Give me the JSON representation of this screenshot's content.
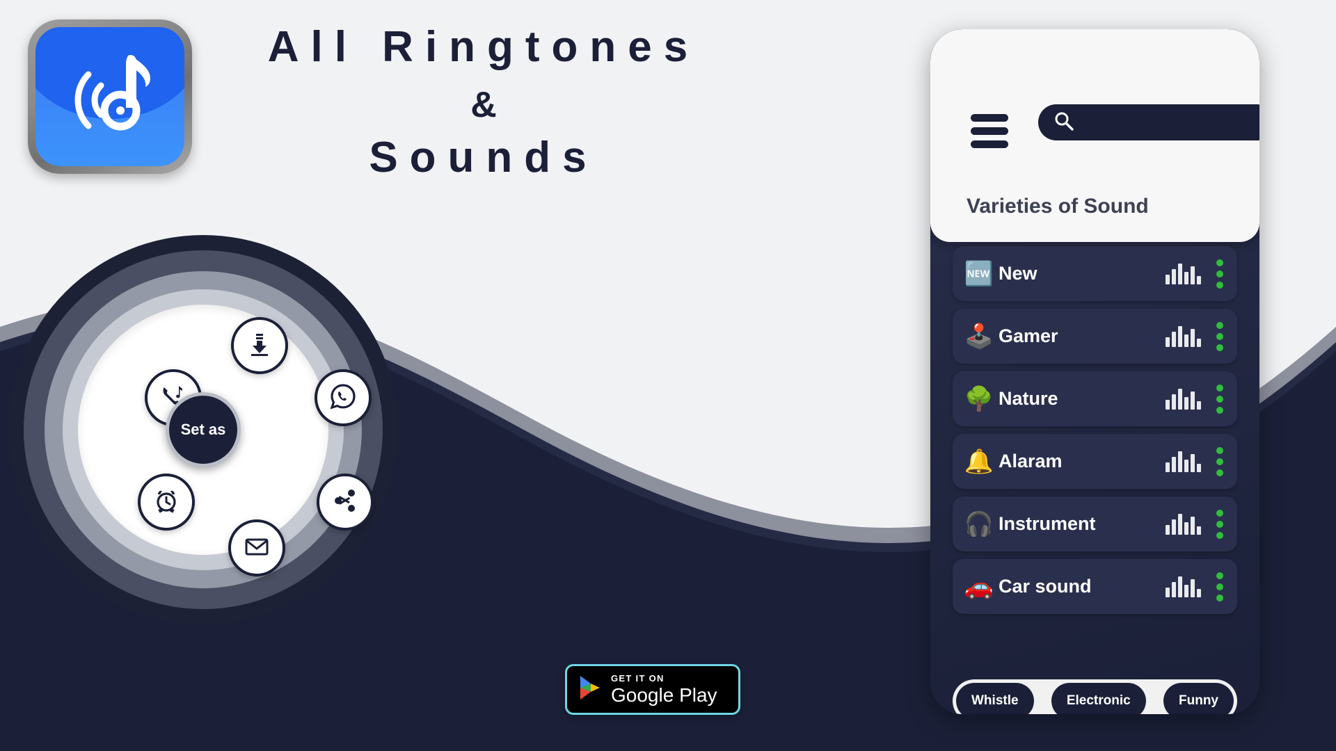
{
  "app": {
    "icon_name": "music-note-waves-icon",
    "icon_colors": {
      "bg_top": "#1f63ef",
      "bg_bottom": "#3d93fb",
      "frame": "#8b8b8b"
    }
  },
  "title": {
    "line1": "All Ringtones",
    "line2": "&",
    "line3": "Sounds",
    "color": "#1b1f38"
  },
  "radial_menu": {
    "center_label": "Set as",
    "center_color": "#1b2038",
    "items": [
      {
        "name": "download",
        "icon": "download-icon"
      },
      {
        "name": "ringtone",
        "icon": "phone-music-icon"
      },
      {
        "name": "whatsapp",
        "icon": "whatsapp-icon"
      },
      {
        "name": "alarm",
        "icon": "alarm-clock-icon"
      },
      {
        "name": "share",
        "icon": "share-icon"
      },
      {
        "name": "mail",
        "icon": "envelope-icon"
      }
    ]
  },
  "play_badge": {
    "top_text": "GET IT ON",
    "bottom_text": "Google Play",
    "icon": "google-play-triangle-icon",
    "border_color": "#6fd6e6",
    "bg_color": "#000000"
  },
  "phone": {
    "menu_icon": "hamburger-menu-icon",
    "search": {
      "icon": "search-icon",
      "value": "",
      "placeholder": ""
    },
    "panel_title": "Varieties of Sound",
    "list": [
      {
        "emoji": "🆕",
        "label": "New",
        "equalizer": [
          14,
          22,
          30,
          18,
          26,
          12
        ],
        "menu_icon": "more-vertical-icon"
      },
      {
        "emoji": "🕹️",
        "label": "Gamer",
        "equalizer": [
          14,
          22,
          30,
          18,
          26,
          12
        ],
        "menu_icon": "more-vertical-icon"
      },
      {
        "emoji": "🌳",
        "label": "Nature",
        "equalizer": [
          14,
          22,
          30,
          18,
          26,
          12
        ],
        "menu_icon": "more-vertical-icon"
      },
      {
        "emoji": "🔔",
        "label": "Alaram",
        "equalizer": [
          14,
          22,
          30,
          18,
          26,
          12
        ],
        "menu_icon": "more-vertical-icon"
      },
      {
        "emoji": "🎧",
        "label": "Instrument",
        "equalizer": [
          14,
          22,
          30,
          18,
          26,
          12
        ],
        "menu_icon": "more-vertical-icon"
      },
      {
        "emoji": "🚗",
        "label": "Car sound",
        "equalizer": [
          14,
          22,
          30,
          18,
          26,
          12
        ],
        "menu_icon": "more-vertical-icon"
      }
    ],
    "chips": [
      {
        "label": "Whistle"
      },
      {
        "label": "Electronic"
      },
      {
        "label": "Funny"
      }
    ],
    "colors": {
      "body": "#232842",
      "row": "#2a2f4d",
      "header": "#f7f7f8",
      "accent_green": "#2fc03a",
      "title_text": "#3d4151"
    }
  },
  "background": {
    "light": "#f1f2f4",
    "wave_dark": "#1b2038"
  }
}
